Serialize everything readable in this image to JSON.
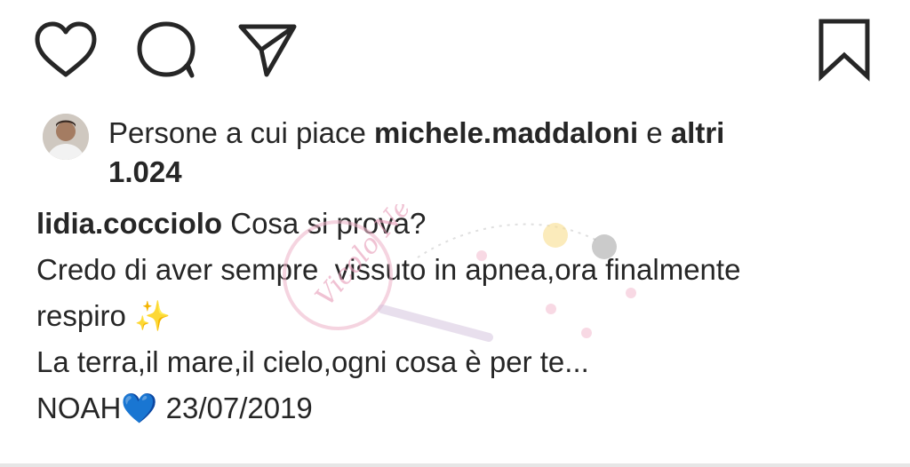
{
  "actions": {
    "like_icon": "heart-outline-icon",
    "comment_icon": "comment-bubble-icon",
    "share_icon": "paper-plane-icon",
    "save_icon": "bookmark-outline-icon"
  },
  "likes": {
    "prefix": "Persone a cui piace",
    "user": "michele.maddaloni",
    "conjunction": "e",
    "others_label": "altri",
    "count": "1.024"
  },
  "caption": {
    "username": "lidia.cocciolo",
    "line1": "Cosa si prova?",
    "line2": "Credo di aver sempre  vissuto in apnea,ora finalmente",
    "line3": "respiro",
    "line3_emoji": "✨",
    "line4": "La terra,il mare,il cielo,ogni cosa è per te...",
    "line5_text": "NOAH",
    "line5_emoji": "💙",
    "line5_date": "23/07/2019"
  },
  "watermark_text": "Vicolo News",
  "colors": {
    "text": "#262626",
    "watermark": "#e8a0bb",
    "heart_blue": "#2f8be6"
  }
}
